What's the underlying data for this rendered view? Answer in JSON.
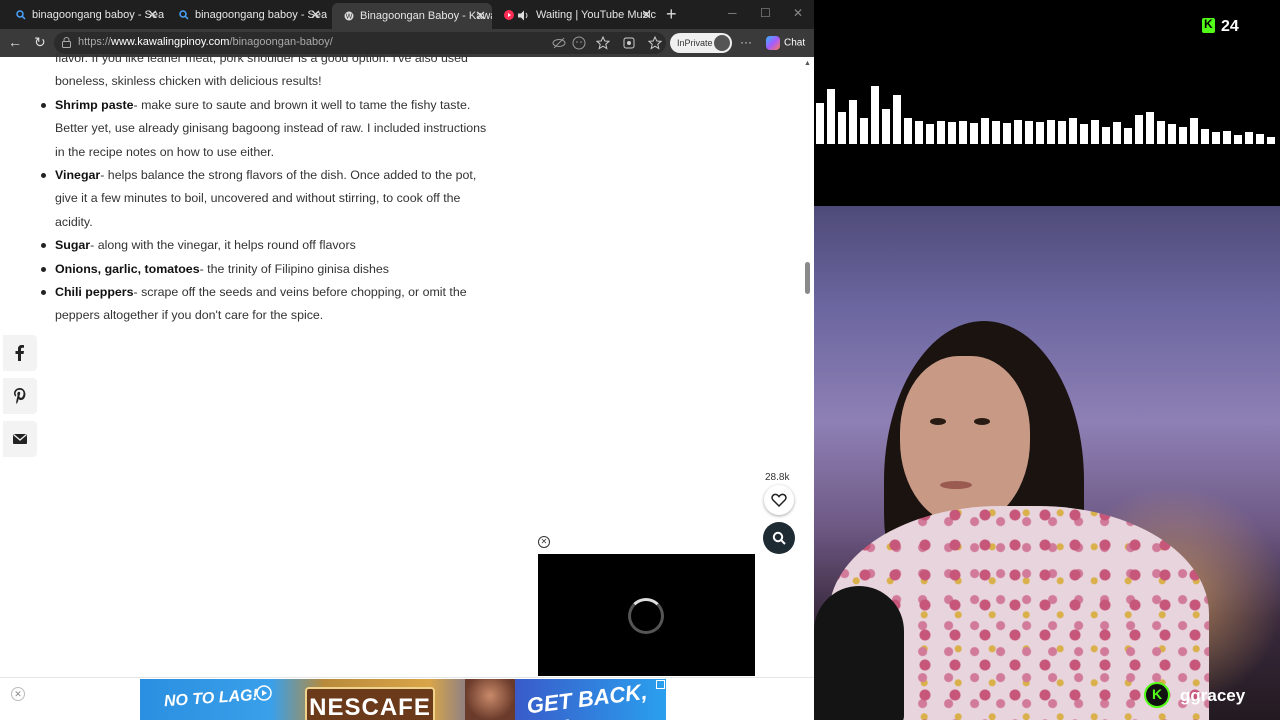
{
  "tabs": [
    {
      "title": "binagoongang baboy - Search",
      "active": false
    },
    {
      "title": "binagoongang baboy - Search",
      "active": false
    },
    {
      "title": "Binagoongan Baboy - Kawaling",
      "active": true
    },
    {
      "title": "Waiting | YouTube Music",
      "active": false
    }
  ],
  "address": {
    "prefix": "https://",
    "domain": "www.kawalingpinoy.com",
    "path": "/binagoongan-baboy/"
  },
  "toolbar": {
    "inprivate_label": "InPrivate",
    "chat_label": "Chat"
  },
  "article": {
    "partial_line_1": "flavor. If you like leaner meat, pork shoulder is a good option. I've also used",
    "partial_line_2": "boneless, skinless chicken with delicious results!",
    "items": [
      {
        "term": "Shrimp paste",
        "lines": [
          "- make sure to saute and brown it well to tame the fishy taste.",
          "Better yet, use already ginisang bagoong instead of raw. I included instructions",
          "in the recipe notes on how to use either."
        ]
      },
      {
        "term": "Vinegar",
        "lines": [
          "- helps balance the strong flavors of the dish. Once added to the pot,",
          "give it a few minutes to boil, uncovered and without stirring, to cook off the",
          "acidity."
        ]
      },
      {
        "term": "Sugar",
        "lines": [
          "- along with the vinegar, it helps round off flavors"
        ]
      },
      {
        "term": "Onions, garlic, tomatoes",
        "lines": [
          "- the trinity of Filipino ginisa dishes"
        ]
      },
      {
        "term": "Chili peppers",
        "lines": [
          "- scrape off the seeds and veins before chopping, or omit the",
          "peppers altogether if you don't care for the spice."
        ]
      }
    ]
  },
  "share": {
    "icons": [
      "facebook-icon",
      "pinterest-icon",
      "email-icon"
    ]
  },
  "likes": {
    "count": "28.8k"
  },
  "ad": {
    "left_text": "NO TO LAG!",
    "brand": "NESCAFE",
    "right_text": "GET BACK, ON!"
  },
  "stream": {
    "viewer_count": "24",
    "streamer_name": "ggracey",
    "accent_color": "#53fc18",
    "visualizer_levels": [
      0.7,
      0.95,
      0.55,
      0.75,
      0.45,
      1.0,
      0.6,
      0.85,
      0.45,
      0.4,
      0.35,
      0.4,
      0.38,
      0.4,
      0.36,
      0.45,
      0.4,
      0.36,
      0.42,
      0.4,
      0.38,
      0.42,
      0.4,
      0.45,
      0.35,
      0.42,
      0.3,
      0.38,
      0.28,
      0.5,
      0.55,
      0.4,
      0.35,
      0.3,
      0.45,
      0.25,
      0.2,
      0.22,
      0.15,
      0.2,
      0.18,
      0.12
    ]
  }
}
